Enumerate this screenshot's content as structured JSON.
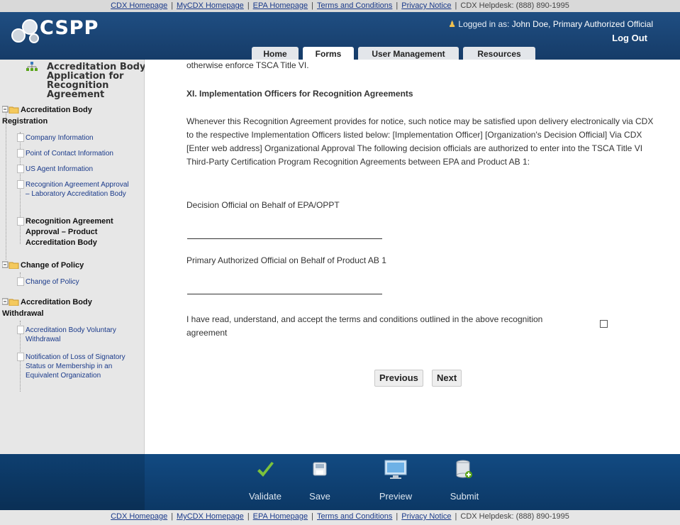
{
  "top_links": {
    "cdx_home": "CDX Homepage",
    "mycdx_home": "MyCDX Homepage",
    "epa_home": "EPA Homepage",
    "terms": "Terms and Conditions",
    "privacy": "Privacy Notice",
    "helpdesk": "CDX Helpdesk: (888) 890-1995"
  },
  "header": {
    "logo_text": "CSPP",
    "logged_in_prefix": "Logged in as: ",
    "logged_in_user": "John Doe, Primary Authorized Official",
    "logout": "Log Out"
  },
  "tabs": [
    "Home",
    "Forms",
    "User Management",
    "Resources"
  ],
  "sidebar": {
    "title": "Accreditation Body Application for Recognition Agreement",
    "groups": [
      {
        "label": "Accreditation Body Registration",
        "items": [
          "Company Information",
          "Point of Contact Information",
          "US Agent Information",
          "Recognition Agreement Approval – Laboratory Accreditation Body",
          "Recognition Agreement Approval – Product Accreditation Body"
        ]
      },
      {
        "label": "Change of Policy",
        "items": [
          "Change of Policy"
        ]
      },
      {
        "label": "Accreditation Body Withdrawal",
        "items": [
          "Accreditation Body Voluntary Withdrawal",
          "Notification of Loss of Signatory Status or Membership in an Equivalent Organization"
        ]
      }
    ]
  },
  "main": {
    "intro_tail": "otherwise enforce TSCA Title VI.",
    "section_heading": "XI. Implementation Officers for Recognition Agreements",
    "paragraph": "Whenever this Recognition Agreement provides for notice, such notice may be satisfied upon delivery electronically via CDX to the respective Implementation Officers listed below: [Implementation Officer] [Organization's Decision Official] Via CDX [Enter web address] Organizational Approval The following decision officials are authorized to enter into the TSCA Title VI Third-Party Certification Program Recognition Agreements between EPA and Product AB 1:",
    "signer1": "Decision Official on Behalf of EPA/OPPT",
    "signer2": "Primary Authorized Official on Behalf of Product AB 1",
    "accept_text": "I have read, understand, and accept the terms and conditions outlined in the above recognition agreement",
    "previous": "Previous",
    "next": "Next"
  },
  "toolbar": {
    "validate": "Validate",
    "save": "Save",
    "preview": "Preview",
    "submit": "Submit"
  },
  "colors": {
    "header": "#1f4e82",
    "toolbar": "#124a82",
    "sidebar": "#e7e7e7",
    "check": "#5aa51a"
  }
}
